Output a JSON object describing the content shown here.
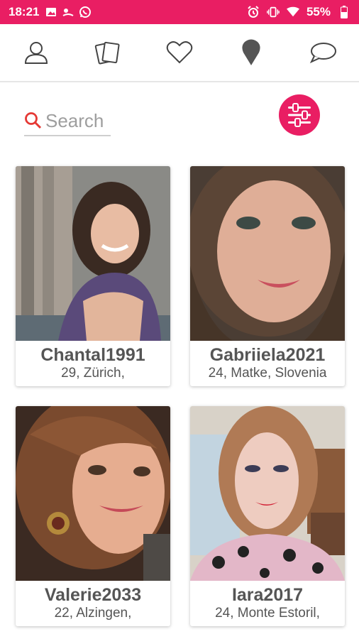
{
  "status_bar": {
    "time": "18:21",
    "battery": "55%",
    "left_icons": [
      "image-icon",
      "weather-icon",
      "whatsapp-icon"
    ],
    "right_icons": [
      "alarm-icon",
      "vibrate-icon",
      "wifi-icon",
      "battery-icon"
    ]
  },
  "nav": {
    "items": [
      "profile-icon",
      "cards-icon",
      "heart-icon",
      "location-pin-icon",
      "chat-icon"
    ]
  },
  "search": {
    "placeholder": "Search"
  },
  "colors": {
    "accent": "#e91e63",
    "text": "#555555"
  },
  "profiles": [
    {
      "name": "Chantal1991",
      "location": "29, Zürich,"
    },
    {
      "name": "Gabriiela2021",
      "location": "24, Matke, Slovenia"
    },
    {
      "name": "Valerie2033",
      "location": "22, Alzingen,"
    },
    {
      "name": "Iara2017",
      "location": "24, Monte Estoril,"
    }
  ]
}
